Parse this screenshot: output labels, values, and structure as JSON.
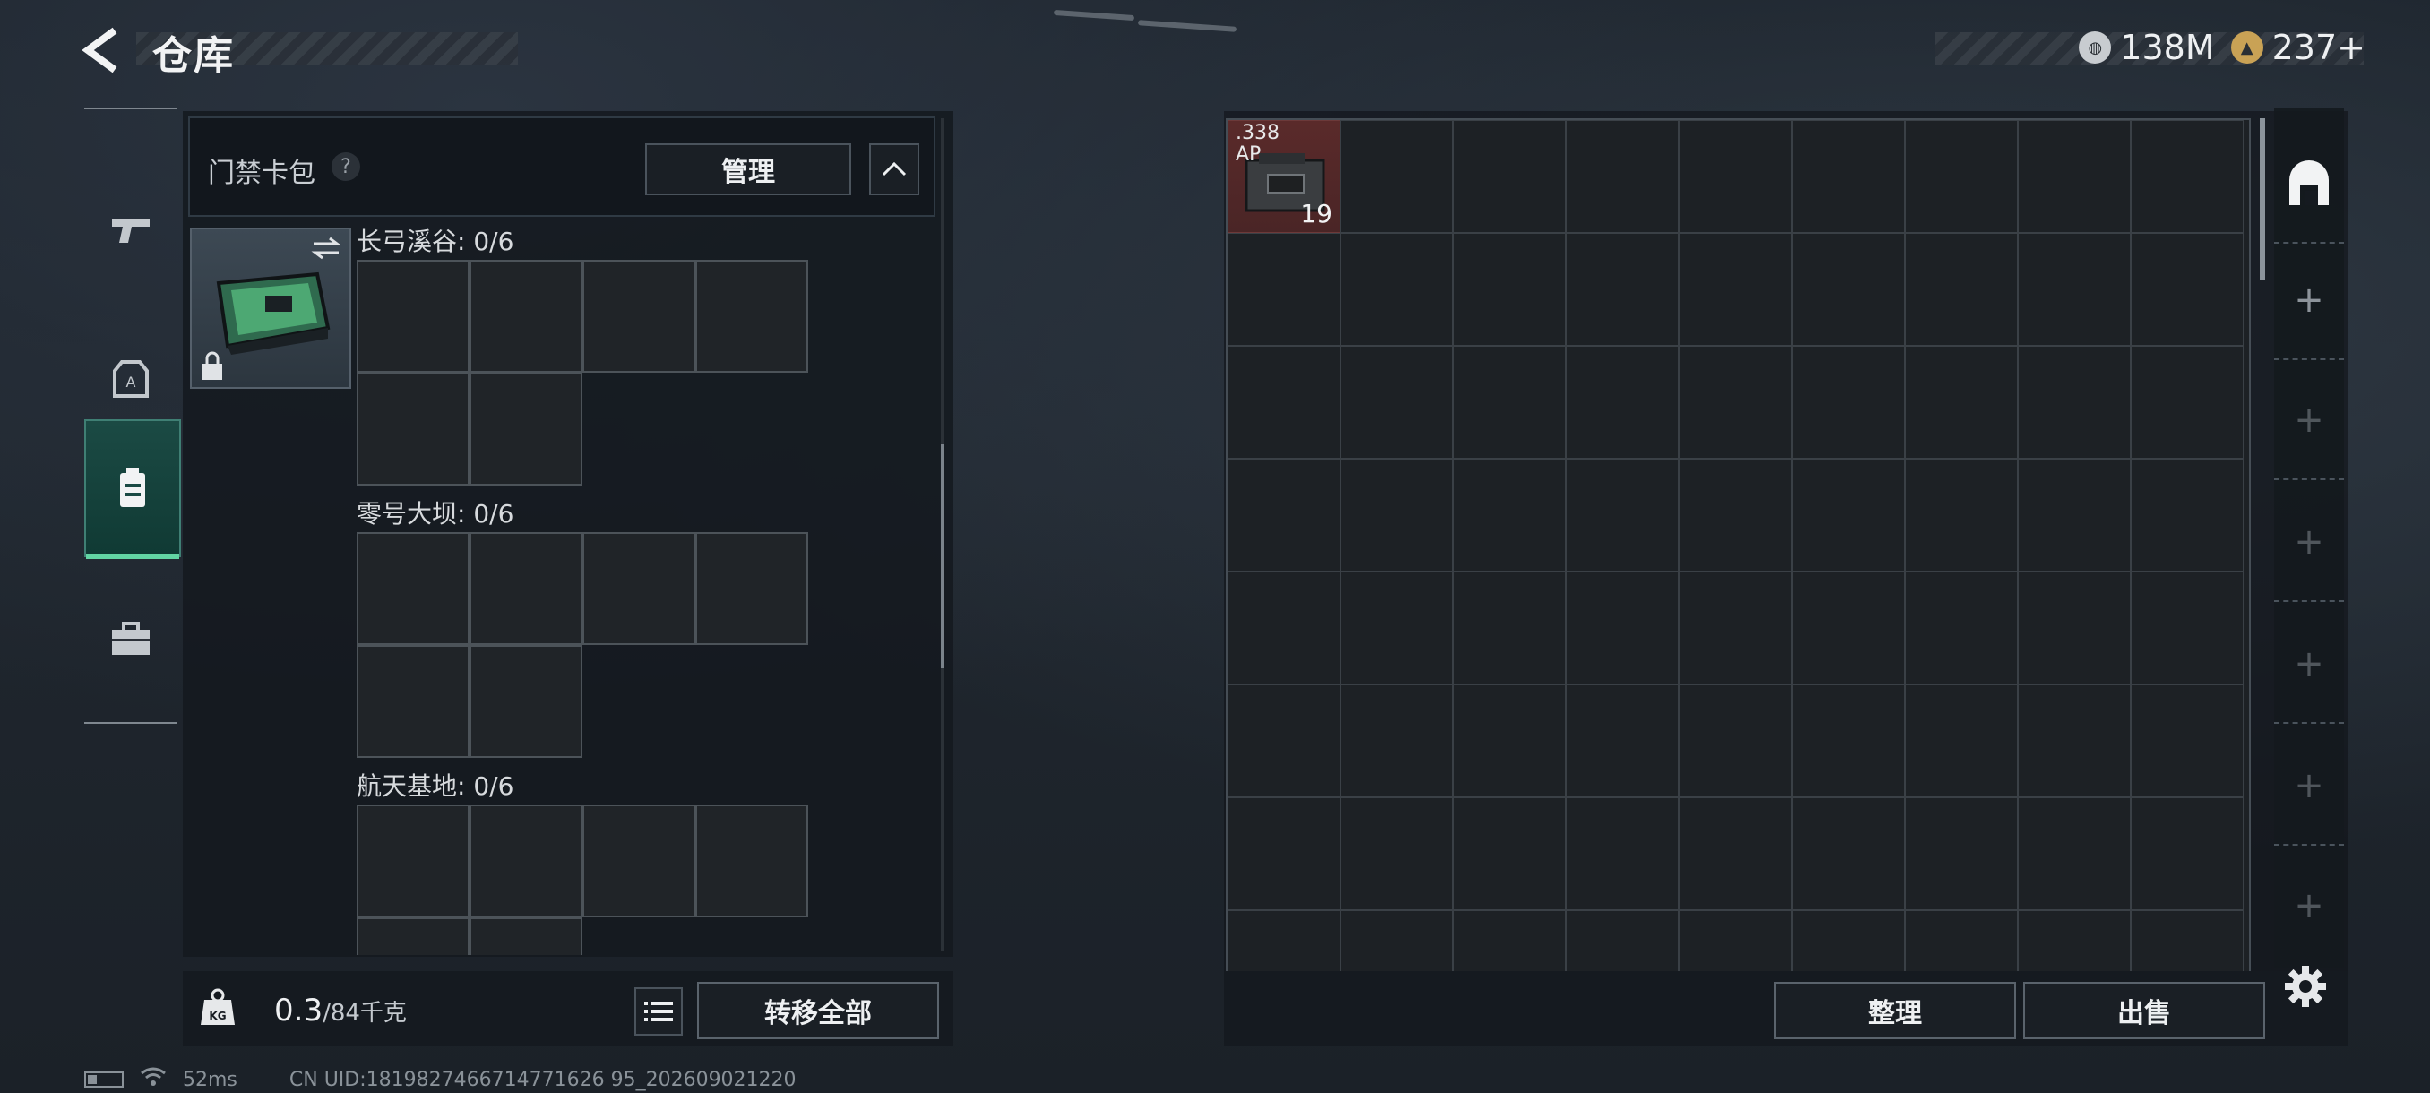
{
  "header": {
    "title": "仓库",
    "currency_silver": "138M",
    "currency_gold": "237+"
  },
  "nav": {
    "items": [
      {
        "name": "weapons",
        "icon": "pistol-icon"
      },
      {
        "name": "gear",
        "icon": "vest-icon"
      },
      {
        "name": "keycards",
        "icon": "keycard-bag-icon",
        "active": true
      },
      {
        "name": "tools",
        "icon": "toolbox-icon"
      }
    ]
  },
  "keycard_panel": {
    "title": "门禁卡包",
    "help": "?",
    "manage_label": "管理",
    "maps": [
      {
        "label": "长弓溪谷: 0/6"
      },
      {
        "label": "零号大坝: 0/6"
      },
      {
        "label": "航天基地: 0/6"
      }
    ]
  },
  "weight": {
    "current": "0.3",
    "max": "/84千克"
  },
  "buttons": {
    "transfer_all": "转移全部",
    "sort": "整理",
    "sell": "出售"
  },
  "stash": {
    "item": {
      "name": ".338 AP",
      "count": "19"
    },
    "tabs": [
      "+",
      "+",
      "+",
      "+",
      "+",
      "+"
    ]
  },
  "status": {
    "ping": "52ms",
    "uid": "CN UID:1819827466714771626 95_202609021220"
  },
  "colors": {
    "accent_green": "#62d4a3",
    "item_red": "#5a2a2a"
  }
}
